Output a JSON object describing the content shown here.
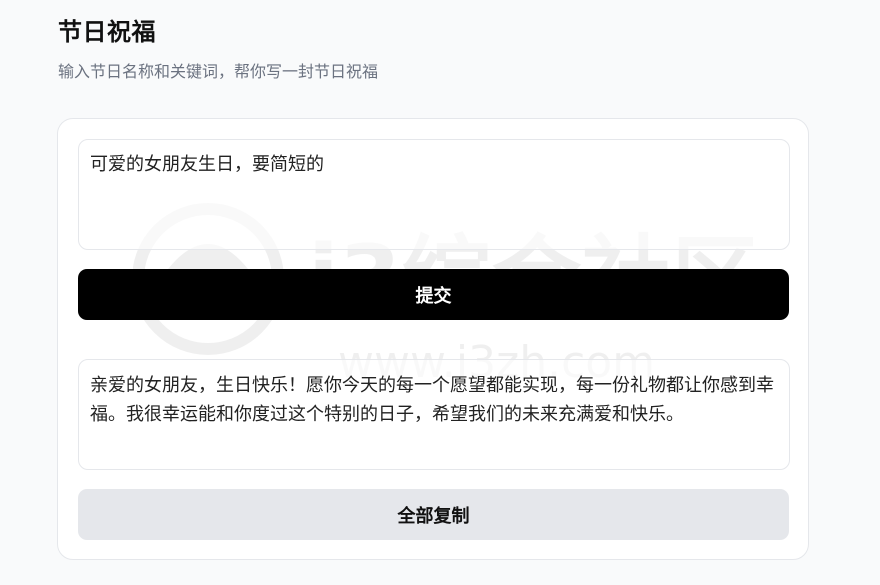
{
  "header": {
    "title": "节日祝福",
    "subtitle": "输入节日名称和关键词，帮你写一封节日祝福"
  },
  "form": {
    "input_value": "可爱的女朋友生日，要简短的",
    "submit_label": "提交"
  },
  "result": {
    "text": "亲爱的女朋友，生日快乐！愿你今天的每一个愿望都能实现，每一份礼物都让你感到幸福。我很幸运能和你度过这个特别的日子，希望我们的未来充满爱和快乐。",
    "copy_label": "全部复制"
  },
  "watermark": {
    "brand": "i3综合社区",
    "url": "www.i3zh.com"
  },
  "colors": {
    "background": "#f9fafb",
    "primary_button": "#000000",
    "secondary_button": "#e5e7eb",
    "border": "#e5e7eb",
    "subtitle": "#6b7280"
  }
}
